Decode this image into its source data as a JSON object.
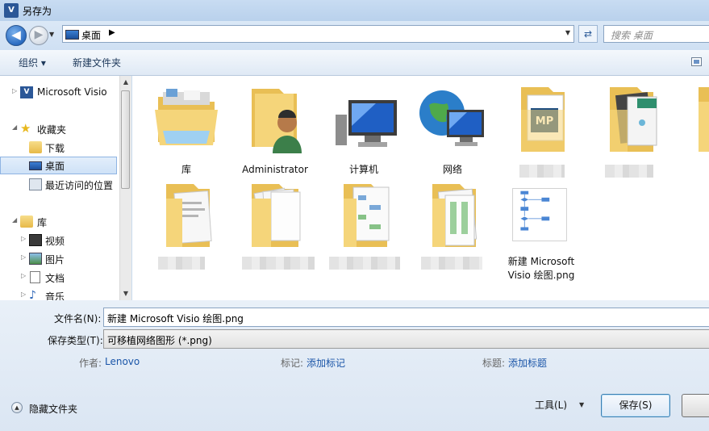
{
  "window": {
    "title": "另存为",
    "app_icon_text": "V"
  },
  "nav": {
    "back_glyph": "◀",
    "forward_glyph": "▶",
    "address": "桌面",
    "search_placeholder": "搜索 桌面"
  },
  "toolbar": {
    "organize": "组织 ▾",
    "new_folder": "新建文件夹"
  },
  "sidebar": {
    "items": [
      {
        "label": "Microsoft Visio",
        "icon": "visio-icon"
      },
      {
        "label": "收藏夹",
        "icon": "star-icon"
      },
      {
        "label": "下载",
        "icon": "download-folder-icon"
      },
      {
        "label": "桌面",
        "icon": "desktop-icon"
      },
      {
        "label": "最近访问的位置",
        "icon": "recent-places-icon"
      },
      {
        "label": "库",
        "icon": "library-icon"
      },
      {
        "label": "视频",
        "icon": "video-icon"
      },
      {
        "label": "图片",
        "icon": "picture-icon"
      },
      {
        "label": "文档",
        "icon": "document-icon"
      },
      {
        "label": "音乐",
        "icon": "music-icon"
      }
    ]
  },
  "files": [
    {
      "caption": "库",
      "icon": "library-folder-icon"
    },
    {
      "caption": "Administrator",
      "icon": "user-folder-icon"
    },
    {
      "caption": "计算机",
      "icon": "computer-icon"
    },
    {
      "caption": "网络",
      "icon": "network-icon"
    },
    {
      "caption": "2",
      "icon": "folder-icon"
    },
    {
      "caption": "",
      "icon": "folder-icon"
    },
    {
      "caption": "",
      "icon": "folder-icon"
    },
    {
      "caption": "",
      "icon": "folder-icon"
    },
    {
      "caption": "",
      "icon": "folder-icon"
    },
    {
      "caption": "",
      "icon": "folder-icon"
    },
    {
      "caption": "",
      "icon": "folder-icon"
    },
    {
      "caption": "新建 Microsoft Visio 绘图.png",
      "icon": "flowchart-thumbnail-icon"
    }
  ],
  "form": {
    "filename_label": "文件名(N):",
    "filename_value": "新建 Microsoft Visio 绘图.png",
    "filetype_label": "保存类型(T):",
    "filetype_value": "可移植网络图形 (*.png)",
    "author_label": "作者:",
    "author_value": "Lenovo",
    "tags_label": "标记:",
    "tags_value": "添加标记",
    "title_label": "标题:",
    "title_value": "添加标题"
  },
  "buttons": {
    "hide_folders": "隐藏文件夹",
    "tools": "工具(L)",
    "save": "保存(S)",
    "cancel": ""
  },
  "colors": {
    "title_bar": "#c8dcf2",
    "link": "#1a55a8",
    "folder": "#f2cf6a",
    "selection": "#cfe2f7"
  }
}
